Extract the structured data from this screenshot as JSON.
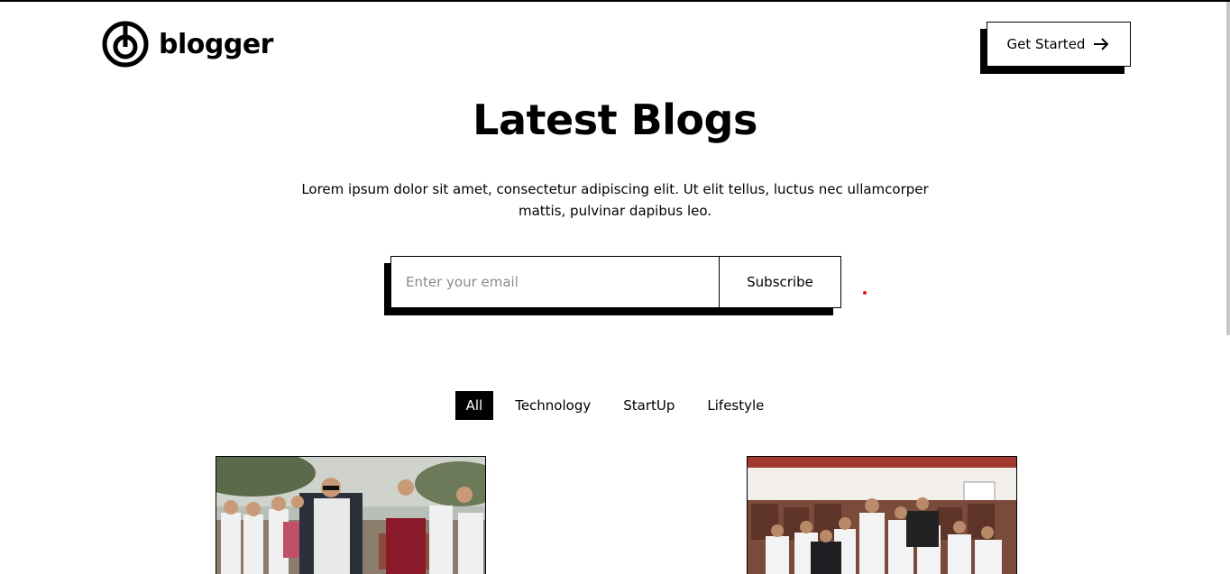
{
  "header": {
    "brand_name": "blogger",
    "cta_label": "Get Started"
  },
  "hero": {
    "title": "Latest Blogs",
    "description": "Lorem ipsum dolor sit amet, consectetur adipiscing elit. Ut elit tellus, luctus nec ullamcorper mattis, pulvinar dapibus leo."
  },
  "subscribe": {
    "placeholder": "Enter your email",
    "value": "",
    "button_label": "Subscribe"
  },
  "filters": {
    "tabs": [
      {
        "label": "All",
        "active": true
      },
      {
        "label": "Technology",
        "active": false
      },
      {
        "label": "StartUp",
        "active": false
      },
      {
        "label": "Lifestyle",
        "active": false
      }
    ]
  },
  "icons": {
    "brand": "logo-mark-icon",
    "cta": "arrow-right-icon"
  },
  "colors": {
    "primary": "#000000",
    "background": "#ffffff",
    "placeholder": "#8a8a8a"
  }
}
